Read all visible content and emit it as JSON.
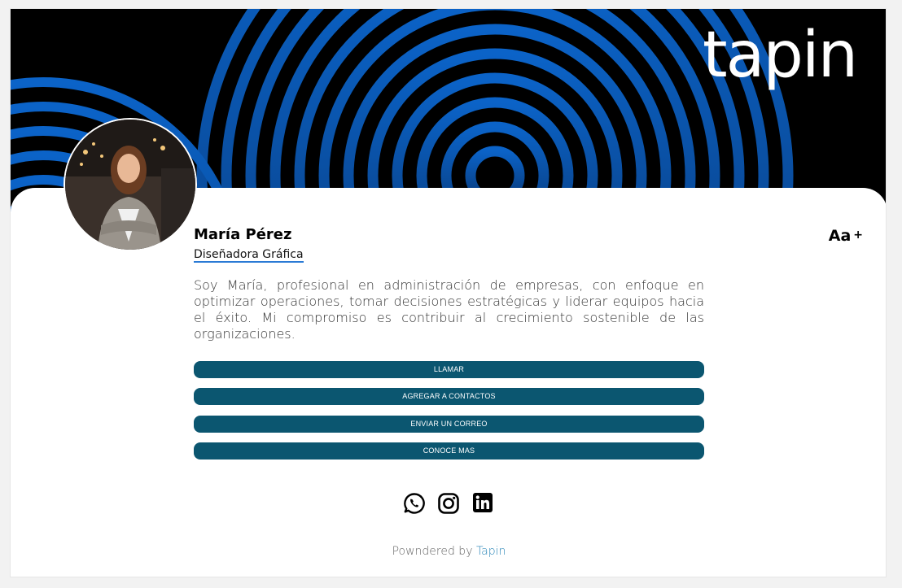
{
  "brand": {
    "logo_text": "tapin"
  },
  "profile": {
    "name": "María Pérez",
    "role": "Diseñadora Gráfica",
    "bio": "Soy María, profesional en administración de empresas, con enfoque en optimizar operaciones, tomar decisiones estratégicas y liderar equipos hacia el éxito. Mi compromiso es contribuir al crecimiento sostenible de las organizaciones."
  },
  "font_size_control": {
    "label": "Aa",
    "plus": "+"
  },
  "actions": [
    {
      "label": "LLAMAR"
    },
    {
      "label": "AGREGAR A CONTACTOS"
    },
    {
      "label": "ENVIAR UN CORREO"
    },
    {
      "label": "CONOCE MAS"
    }
  ],
  "social": [
    {
      "icon": "whatsapp-icon"
    },
    {
      "icon": "instagram-icon"
    },
    {
      "icon": "linkedin-icon"
    }
  ],
  "footer": {
    "prefix": "Powndered by",
    "link": "Tapin"
  },
  "colors": {
    "button_bg": "#0b5670",
    "accent_underline": "#2a7ad5",
    "banner_rings": "#0a5cc0",
    "footer_link": "#2a86b8"
  }
}
